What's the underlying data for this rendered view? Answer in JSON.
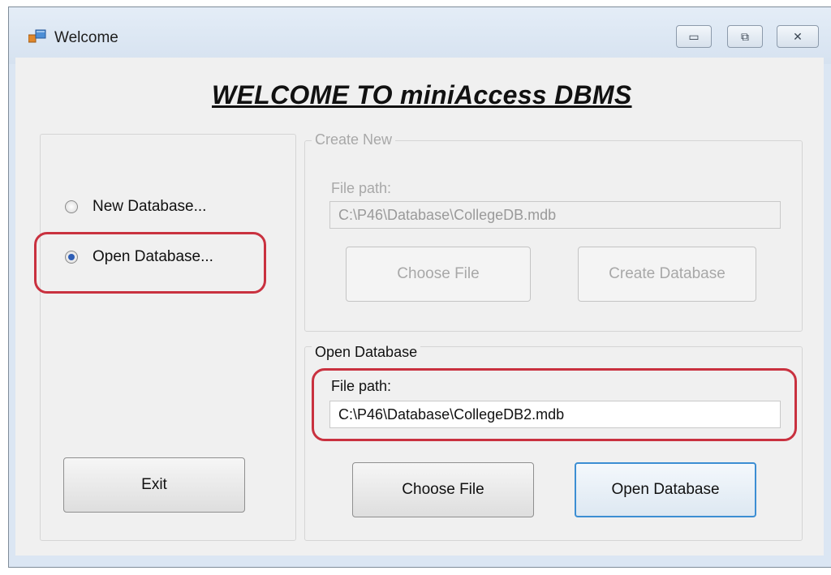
{
  "window": {
    "title": "Welcome",
    "minimize_glyph": "▭",
    "restore_glyph": "⧉",
    "close_glyph": "✕"
  },
  "heading": "WELCOME TO miniAccess DBMS",
  "options": {
    "new_database": "New Database...",
    "open_database": "Open Database...",
    "selected": "open_database"
  },
  "create_new": {
    "legend": "Create New",
    "file_path_label": "File path:",
    "file_path_value": "C:\\P46\\Database\\CollegeDB.mdb",
    "choose_file_label": "Choose File",
    "create_database_label": "Create Database",
    "enabled": false
  },
  "open_database": {
    "legend": "Open Database",
    "file_path_label": "File path:",
    "file_path_value": "C:\\P46\\Database\\CollegeDB2.mdb",
    "choose_file_label": "Choose File",
    "open_database_label": "Open Database",
    "enabled": true
  },
  "exit_label": "Exit",
  "colors": {
    "highlight": "#c9313f",
    "default_button_border": "#3c8ed3",
    "disabled_text": "#a8a8a8"
  }
}
